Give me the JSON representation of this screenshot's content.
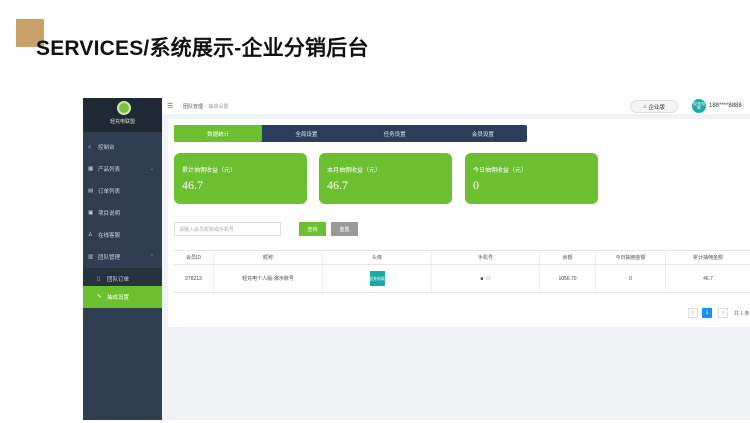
{
  "page_title": "SERVICES/系统展示-企业分销后台",
  "sidebar": {
    "logo_text": "轻充电联盟",
    "items": [
      {
        "label": "控制台",
        "icon": "home-icon"
      },
      {
        "label": "产品列表",
        "icon": "grid-icon",
        "has_chevron": true
      },
      {
        "label": "订单列表",
        "icon": "cart-icon"
      },
      {
        "label": "项目说明",
        "icon": "doc-icon"
      },
      {
        "label": "在线客服",
        "icon": "user-icon"
      },
      {
        "label": "团队管理",
        "icon": "team-icon",
        "has_chevron": true
      },
      {
        "label": "团队订单",
        "icon": "file-icon"
      },
      {
        "label": "抽成设置",
        "icon": "edit-icon",
        "active": true
      }
    ],
    "active_color": "#6cbf2f"
  },
  "topbar": {
    "breadcrumb": [
      "团队管理",
      "抽成设置"
    ],
    "edition_button": "企业版",
    "avatar_text": "轻充电联",
    "user_phone": "188****8888"
  },
  "tabs": [
    {
      "label": "数据统计",
      "active": true
    },
    {
      "label": "全局设置"
    },
    {
      "label": "任务设置"
    },
    {
      "label": "会员设置"
    }
  ],
  "stats": [
    {
      "label": "累计抽佣收益（元）",
      "value": "46.7"
    },
    {
      "label": "本月抽佣收益（元）",
      "value": "46.7"
    },
    {
      "label": "今日抽佣收益（元）",
      "value": "0"
    }
  ],
  "search": {
    "placeholder": "请输入会员昵称或手机号",
    "query_button": "查询",
    "reset_button": "重置"
  },
  "table": {
    "headers": [
      "会员ID",
      "昵称",
      "头像",
      "手机号",
      "余额",
      "今日抽佣金额",
      "累计抽佣金额"
    ],
    "rows": [
      {
        "id": "278213",
        "nickname": "轻充电个人版-演示账号",
        "avatar_text": "轻充电联",
        "phone": "■ □",
        "balance": "1056.70",
        "today": "0",
        "total": "46.7"
      }
    ]
  },
  "pagination": {
    "prev": "<",
    "current": "1",
    "next": ">",
    "total_text": "共 1 条"
  },
  "colors": {
    "accent_green": "#6cbf2f",
    "nav_dark": "#2f3e50",
    "tab_bar": "#2b3f5c",
    "brand_teal": "#18a9a9"
  }
}
